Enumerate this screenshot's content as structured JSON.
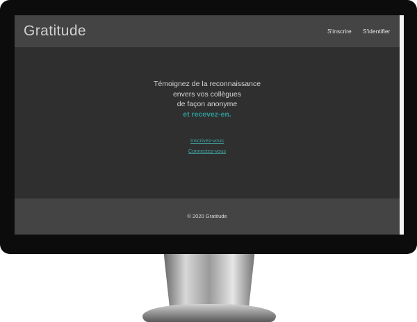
{
  "header": {
    "brand": "Gratitude",
    "nav": {
      "signup": "S'inscrire",
      "login": "S'identifier"
    }
  },
  "main": {
    "tagline": [
      "Témoignez de la reconnaissance",
      "envers vos collègues",
      "de façon anonyme"
    ],
    "tagline_accent": "et recevez-en.",
    "cta_signup": "Inscrivez-vous",
    "cta_login": "Connectez-vous"
  },
  "footer": {
    "copyright": "© 2020 Gratitude"
  },
  "colors": {
    "screen_bg": "#2f2f2f",
    "header_bg": "#444444",
    "accent": "#2f9a98"
  }
}
